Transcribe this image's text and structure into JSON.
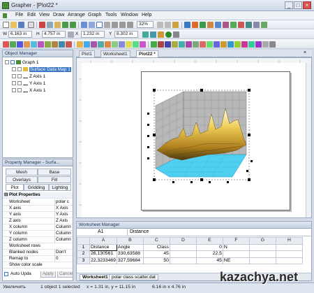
{
  "window": {
    "title": "Grapher - [Plot22 *"
  },
  "menu": [
    "File",
    "Edit",
    "View",
    "Draw",
    "Arrange",
    "Graph",
    "Tools",
    "Window",
    "Help"
  ],
  "toolbar2": {
    "zoom": "32%"
  },
  "toolbar3": {
    "w_label": "W",
    "w_value": "6.163 in",
    "h_label": "H",
    "h_value": "4.757 in",
    "x_label": "X",
    "x_value": "1.232 in",
    "y_label": "Y",
    "y_value": "8.302 in"
  },
  "object_manager": {
    "title": "Object Manager",
    "items": [
      "Graph 1",
      "Surface Data Map 1",
      "Z Axis 1",
      "Y Axis 1",
      "X Axis 1"
    ]
  },
  "property_manager": {
    "title": "Property Manager - Surfa...",
    "tabs_row1": [
      "Mesh",
      "Base"
    ],
    "tabs_row2": [
      "Overlays",
      "Fill"
    ],
    "tabs_row3": [
      "Plot",
      "Gridding",
      "Lighting"
    ],
    "section": "Plot Properties",
    "rows": [
      {
        "k": "Worksheet",
        "v": "polar c"
      },
      {
        "k": "X axis",
        "v": "X Axis"
      },
      {
        "k": "Y axis",
        "v": "Y Axis"
      },
      {
        "k": "Z axis",
        "v": "Z Axis"
      },
      {
        "k": "X column",
        "v": "Column"
      },
      {
        "k": "Y column",
        "v": "Column"
      },
      {
        "k": "Z column",
        "v": "Column"
      },
      {
        "k": "Worksheet rows",
        "v": ""
      },
      {
        "k": "Blanked nodes",
        "v": "Don't"
      },
      {
        "k": "Remap to",
        "v": "0"
      },
      {
        "k": "Show color scale",
        "v": ""
      }
    ],
    "footer": {
      "auto_label": "Auto Upda",
      "apply": "Apply",
      "cancel": "Cancel"
    }
  },
  "doc_tabs": [
    "Plot1",
    "Worksheet1",
    "Plot22 *"
  ],
  "worksheet_manager": {
    "title": "Worksheet Manager",
    "cell_ref": "A1",
    "cell_value": "Distance",
    "columns": [
      "A",
      "B",
      "C",
      "D",
      "E",
      "F",
      "G",
      "H"
    ],
    "rows": [
      [
        "1",
        "Distance",
        "Angle",
        "Class",
        "",
        "0",
        "N",
        "",
        ""
      ],
      [
        "2",
        "26,130561",
        "330,63588",
        "45",
        "",
        "22,5",
        "",
        "",
        ""
      ],
      [
        "3",
        "22,3233469",
        "327,59684",
        "50",
        "",
        "45",
        "NE",
        "",
        ""
      ]
    ],
    "sheet_tabs": [
      "Worksheet1",
      "polar class scatter.dat"
    ]
  },
  "status": {
    "left": "Увеличить",
    "objects": "1 object 1 selected",
    "coords": "x = 1.31 in, y = 11.15 in",
    "size": "6.16 in x 4.76 in"
  },
  "watermark": "kazachya.net",
  "colors": {
    "accent": "#3b78c4",
    "surface_yellow": "#e6b93a",
    "base_cyan": "#4fd0f0"
  }
}
